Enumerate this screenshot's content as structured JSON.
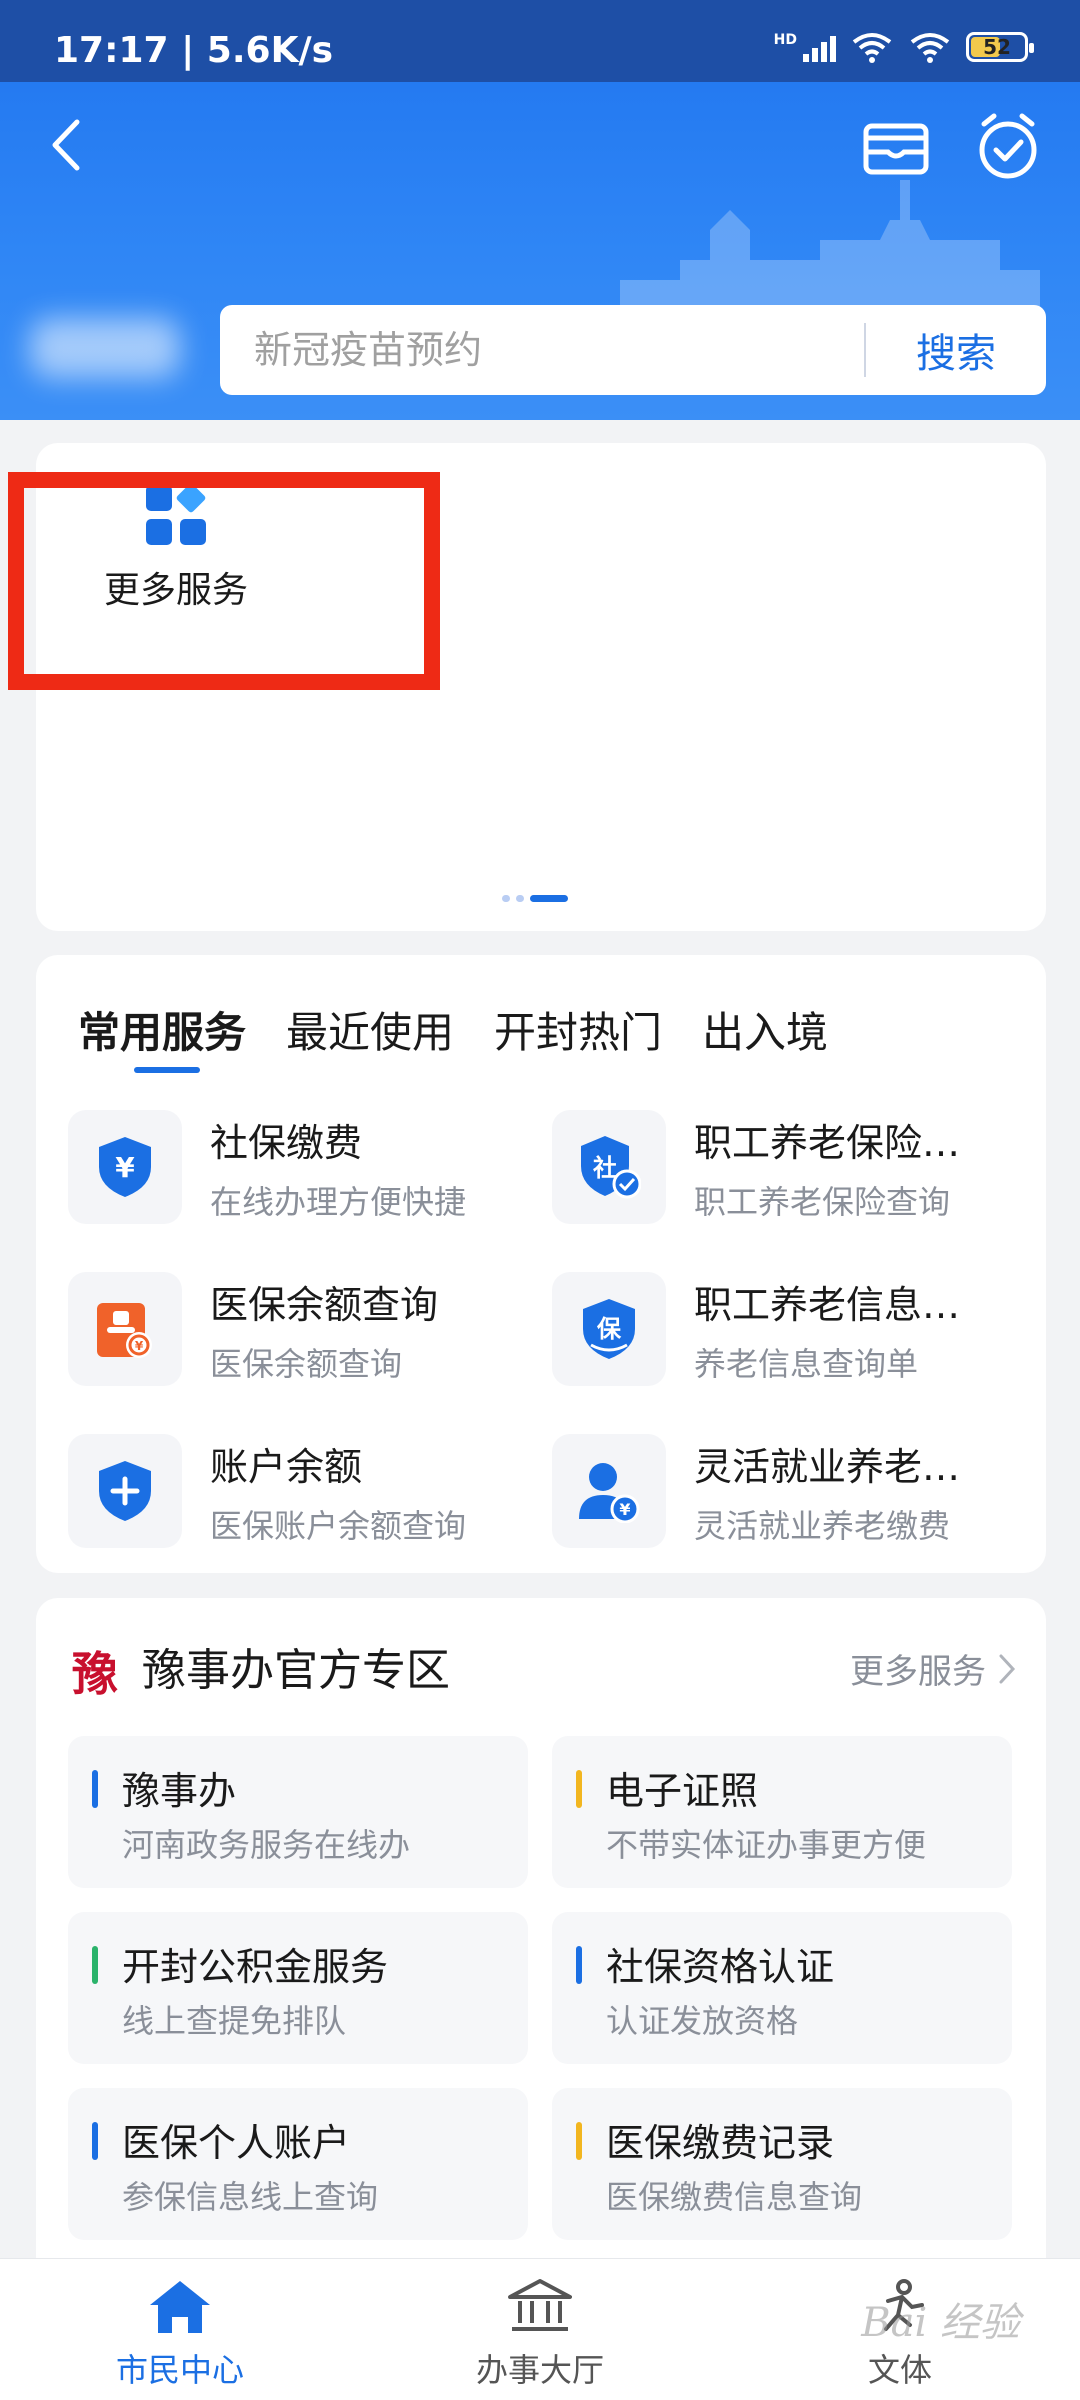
{
  "status_bar": {
    "time": "17:17 | 5.6K/s",
    "network": "HD",
    "battery": "52"
  },
  "header": {
    "title": "",
    "back_icon": "chevron-left-icon",
    "wallet_icon": "card-holder-icon",
    "clock_icon": "alarm-check-icon"
  },
  "search": {
    "placeholder": "新冠疫苗预约",
    "button_label": "搜索"
  },
  "quick_panel": {
    "more_services_label": "更多服务",
    "page_count": 3,
    "active_page": 2
  },
  "common_services": {
    "tabs": [
      {
        "label": "常用服务",
        "active": true
      },
      {
        "label": "最近使用",
        "active": false
      },
      {
        "label": "开封热门",
        "active": false
      },
      {
        "label": "出入境",
        "active": false
      }
    ],
    "items": [
      {
        "title": "社保缴费",
        "subtitle": "在线办理方便快捷",
        "icon": "yuan-shield-icon"
      },
      {
        "title": "职工养老保险…",
        "subtitle": "职工养老保险查询",
        "icon": "social-insurance-shield-icon"
      },
      {
        "title": "医保余额查询",
        "subtitle": "医保余额查询",
        "icon": "medical-card-icon"
      },
      {
        "title": "职工养老信息…",
        "subtitle": "养老信息查询单",
        "icon": "guarantee-shield-icon"
      },
      {
        "title": "账户余额",
        "subtitle": "医保账户余额查询",
        "icon": "plus-shield-icon"
      },
      {
        "title": "灵活就业养老…",
        "subtitle": "灵活就业养老缴费",
        "icon": "user-yuan-icon"
      }
    ]
  },
  "official_zone": {
    "title": "豫事办官方专区",
    "logo_text": "豫",
    "more_label": "更多服务",
    "items": [
      {
        "title": "豫事办",
        "subtitle": "河南政务服务在线办",
        "bar_color": "#1b6fe3"
      },
      {
        "title": "电子证照",
        "subtitle": "不带实体证办事更方便",
        "bar_color": "#f2b620"
      },
      {
        "title": "开封公积金服务",
        "subtitle": "线上查提免排队",
        "bar_color": "#2bb36b"
      },
      {
        "title": "社保资格认证",
        "subtitle": "认证发放资格",
        "bar_color": "#1b6fe3"
      },
      {
        "title": "医保个人账户",
        "subtitle": "参保信息线上查询",
        "bar_color": "#1b6fe3"
      },
      {
        "title": "医保缴费记录",
        "subtitle": "医保缴费信息查询",
        "bar_color": "#f2b620"
      }
    ]
  },
  "bottom_nav": [
    {
      "label": "市民中心",
      "icon": "home-icon",
      "active": true
    },
    {
      "label": "办事大厅",
      "icon": "bank-building-icon",
      "active": false
    },
    {
      "label": "文体",
      "icon": "sports-person-icon",
      "active": false
    }
  ],
  "watermark": "Bai 经验",
  "colors": {
    "primary": "#1b6fe3",
    "header_bg": "#2f86f5",
    "highlight": "#ee2a15"
  }
}
